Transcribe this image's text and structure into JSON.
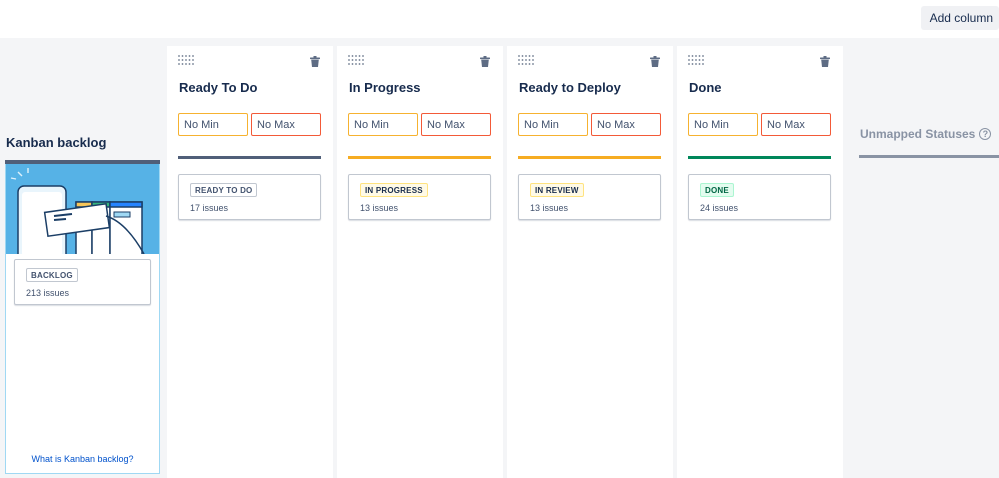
{
  "toolbar": {
    "add_column_label": "Add column"
  },
  "backlog": {
    "title": "Kanban backlog",
    "status_label": "BACKLOG",
    "issues": "213 issues",
    "help_link": "What is Kanban backlog?"
  },
  "columns": [
    {
      "title": "Ready To Do",
      "min_placeholder": "No Min",
      "max_placeholder": "No Max",
      "status_label": "READY TO DO",
      "issues": "17 issues",
      "bar_color": "#505f79"
    },
    {
      "title": "In Progress",
      "min_placeholder": "No Min",
      "max_placeholder": "No Max",
      "status_label": "IN PROGRESS",
      "issues": "13 issues",
      "bar_color": "#f6ac22"
    },
    {
      "title": "Ready to Deploy",
      "min_placeholder": "No Min",
      "max_placeholder": "No Max",
      "status_label": "IN REVIEW",
      "issues": "13 issues",
      "bar_color": "#f6ac22"
    },
    {
      "title": "Done",
      "min_placeholder": "No Min",
      "max_placeholder": "No Max",
      "status_label": "DONE",
      "issues": "24 issues",
      "bar_color": "#00875a"
    }
  ],
  "unmapped": {
    "title": "Unmapped Statuses",
    "help_glyph": "?"
  },
  "icons": {
    "drag": "drag-handle-icon",
    "delete": "trash-icon",
    "help": "question-circle-icon"
  }
}
